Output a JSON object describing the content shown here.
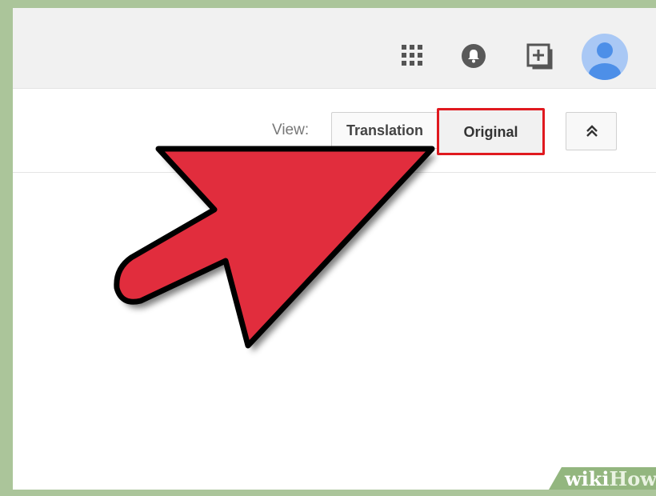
{
  "toolbar": {
    "icons": [
      "apps-grid-icon",
      "notifications-bell-icon",
      "share-add-icon",
      "account-avatar"
    ]
  },
  "view_bar": {
    "label": "View:",
    "translation_button": "Translation",
    "original_button": "Original",
    "collapse_icon": "double-chevron-up-icon"
  },
  "overlay": {
    "arrow_color": "#e12d3d",
    "highlight_color": "#e0191f"
  },
  "watermark": {
    "part1": "wiki",
    "part2": "How"
  },
  "colors": {
    "frame_green": "#abc59a",
    "toolbar_bg": "#f1f1f1",
    "avatar_blue": "#4d8fe8"
  }
}
